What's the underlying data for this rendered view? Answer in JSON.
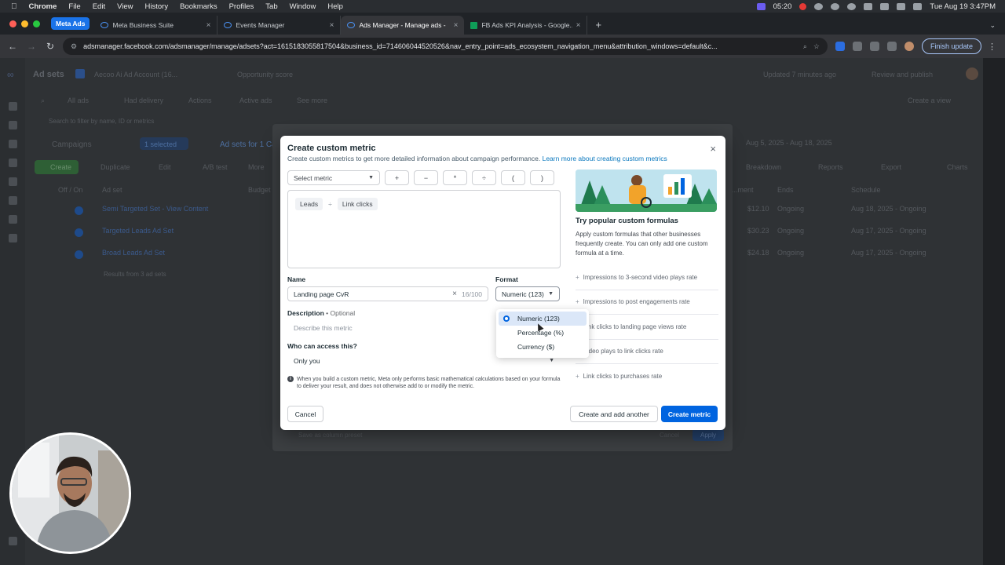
{
  "menubar": {
    "app": "Chrome",
    "menus": [
      "File",
      "Edit",
      "View",
      "History",
      "Bookmarks",
      "Profiles",
      "Tab",
      "Window",
      "Help"
    ],
    "timer": "05:20",
    "datetime": "Tue Aug 19  3:47PM"
  },
  "tabs": {
    "group_label": "Meta Ads",
    "items": [
      {
        "title": "Meta Business Suite",
        "icon": "meta-icon"
      },
      {
        "title": "Events Manager",
        "icon": "meta-icon"
      },
      {
        "title": "Ads Manager - Manage ads -",
        "icon": "meta-icon"
      },
      {
        "title": "FB Ads KPI Analysis - Google...",
        "icon": "sheets-icon"
      }
    ]
  },
  "address": {
    "url": "adsmanager.facebook.com/adsmanager/manage/adsets?act=1615183055817504&business_id=714606044520526&nav_entry_point=ads_ecosystem_navigation_menu&attribution_windows=default&c...",
    "finish_update": "Finish update"
  },
  "background": {
    "page_title": "Ad sets",
    "account": "Aecoo Ai Ad Account (16...",
    "opportunity": "Opportunity score",
    "updated": "Updated 7 minutes ago",
    "review_publish": "Review and publish",
    "filters": [
      "All ads",
      "Had delivery",
      "Actions",
      "Active ads",
      "See more"
    ],
    "create_view": "Create a view",
    "search_placeholder": "Search to filter by name, ID or metrics",
    "campaigns": "Campaigns",
    "selected": "1 selected",
    "adsets_for": "Ad sets for 1 Ca...",
    "date_range": "Aug 5, 2025 - Aug 18, 2025",
    "toolbar": [
      "Create",
      "Duplicate",
      "Edit",
      "A/B test",
      "More"
    ],
    "toolbar_right": [
      "Breakdown",
      "Reports",
      "Export",
      "Charts"
    ],
    "columns": [
      "Off / On",
      "Ad set",
      "Budget",
      "Ends",
      "Schedule",
      "...ment"
    ],
    "rows": [
      {
        "name": "Semi Targeted Set - View Content",
        "amount": "$12.10",
        "ends": "Ongoing",
        "schedule": "Aug 18, 2025 - Ongoing"
      },
      {
        "name": "Targeted Leads Ad Set",
        "amount": "$30.23",
        "ends": "Ongoing",
        "schedule": "Aug 17, 2025 - Ongoing"
      },
      {
        "name": "Broad Leads Ad Set",
        "amount": "$24.18",
        "ends": "Ongoing",
        "schedule": "Aug 17, 2025 - Ongoing"
      }
    ],
    "results_text": "Results from 3 ad sets",
    "save_preset": "Save as column preset",
    "under_cancel": "Cancel",
    "under_apply": "Apply"
  },
  "modal": {
    "title": "Create custom metric",
    "subtitle": "Create custom metrics to get more detailed information about campaign performance.",
    "learn_more": "Learn more about creating custom metrics",
    "select_metric": "Select metric",
    "operators": [
      "+",
      "−",
      "*",
      "÷",
      "(",
      ")"
    ],
    "formula": {
      "left": "Leads",
      "op": "÷",
      "right": "Link clicks"
    },
    "name_label": "Name",
    "name_value": "Landing page CvR",
    "name_count": "16/100",
    "format_label": "Format",
    "format_value": "Numeric (123)",
    "desc_label": "Description",
    "desc_optional": "• Optional",
    "desc_placeholder": "Describe this metric",
    "access_label": "Who can access this?",
    "access_value": "Only you",
    "note": "When you build a custom metric, Meta only performs basic mathematical calculations based on your formula to deliver your result, and does not otherwise add to or modify the metric.",
    "cancel": "Cancel",
    "create_add": "Create and add another",
    "create": "Create metric",
    "popular_title": "Try popular custom formulas",
    "popular_desc": "Apply custom formulas that other businesses frequently create. You can only add one custom formula at a time.",
    "popular_items": [
      "Impressions to 3-second video plays rate",
      "Impressions to post engagements rate",
      "Link clicks to landing page views rate",
      "Video plays to link clicks rate",
      "Link clicks to purchases rate"
    ]
  },
  "format_dropdown": {
    "options": [
      "Numeric (123)",
      "Percentage (%)",
      "Currency ($)"
    ],
    "selected": "Numeric (123)"
  },
  "colors": {
    "primary": "#0064e0",
    "link": "#0a78be",
    "tab_group": "#1a73e8"
  }
}
